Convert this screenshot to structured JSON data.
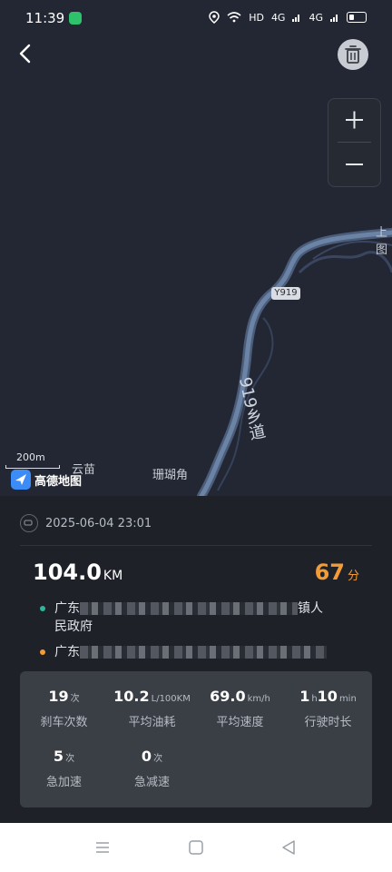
{
  "status_bar": {
    "time": "11:39",
    "network": "HD",
    "signal1": "4G",
    "signal2": "4G"
  },
  "map": {
    "scale_label": "200m",
    "logo_text": "高德地图",
    "road_badge": "Y919",
    "road_name": "919乡道",
    "labels": {
      "yunmiao": "云苗",
      "shanhujiao": "珊瑚角",
      "edge": "上图"
    },
    "zoom_in": "+",
    "zoom_out": "−"
  },
  "trip": {
    "datetime": "2025-06-04 23:01",
    "distance_value": "104.0",
    "distance_unit": "KM",
    "score_value": "67",
    "score_unit": "分",
    "start_prefix": "广东",
    "start_suffix": "镇人",
    "start_line2": "民政府",
    "end_prefix": "广东"
  },
  "stats": [
    {
      "value": "19",
      "unit": "次",
      "label": "刹车次数"
    },
    {
      "value": "10.2",
      "unit": "L/100KM",
      "label": "平均油耗"
    },
    {
      "value": "69.0",
      "unit": "km/h",
      "label": "平均速度"
    },
    {
      "value": "1",
      "unit": "h",
      "value2": "10",
      "unit2": "min",
      "label": "行驶时长"
    },
    {
      "value": "5",
      "unit": "次",
      "label": "急加速"
    },
    {
      "value": "0",
      "unit": "次",
      "label": "急减速"
    }
  ],
  "colors": {
    "score": "#f39c37",
    "start_dot": "#2fb59a",
    "end_dot": "#f39c37",
    "route": "#6b84a6"
  }
}
